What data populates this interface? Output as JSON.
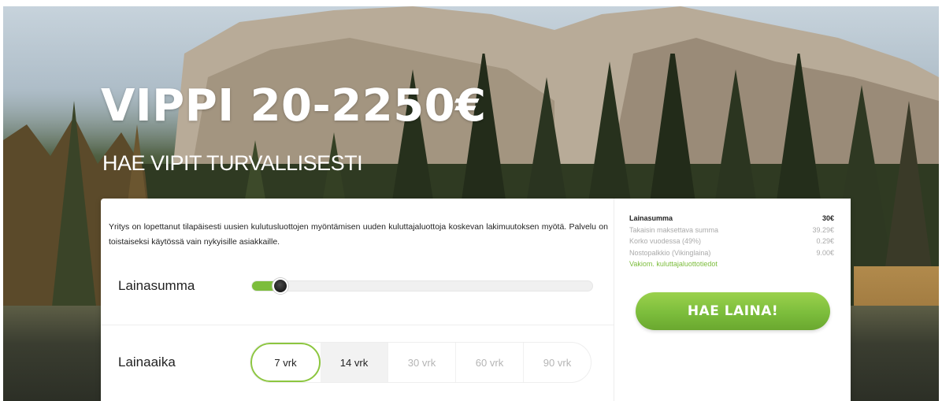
{
  "hero": {
    "title": "VIPPI 20-2250€",
    "subtitle": "HAE VIPIT TURVALLISESTI"
  },
  "notice": "Yritys on lopettanut tilapäisesti uusien kulutusluottojen myöntämisen uuden kuluttajaluottoja koskevan lakimuutoksen myötä. Palvelu on toistaiseksi käytössä vain nykyisille asiakkaille.",
  "loan_amount": {
    "label": "Lainasumma",
    "slider_level": 0.06
  },
  "loan_term": {
    "label": "Lainaaika",
    "options": [
      "7 vrk",
      "14 vrk",
      "30 vrk",
      "60 vrk",
      "90 vrk"
    ],
    "selected": "7 vrk"
  },
  "summary": {
    "rows": [
      {
        "label": "Lainasumma",
        "value": "30€"
      },
      {
        "label": "Takaisin maksettava summa",
        "value": "39.29€"
      },
      {
        "label": "Korko vuodessa (49%)",
        "value": "0.29€"
      },
      {
        "label": "Nostopalkkio (Vikinglaina)",
        "value": "9.00€"
      }
    ],
    "link": "Vakiom. kuluttajaluottotiedot"
  },
  "cta_label": "HAE LAINA!",
  "colors": {
    "accent": "#7cbd3c",
    "knob": "#1b1b1b"
  }
}
